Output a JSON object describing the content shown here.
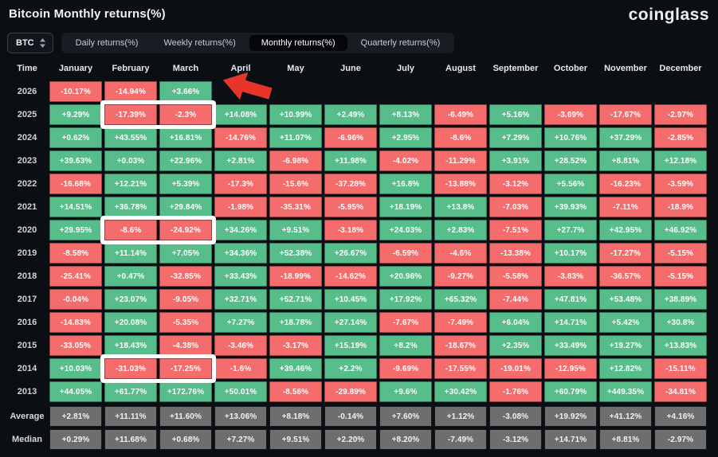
{
  "header": {
    "title": "Bitcoin Monthly returns(%)",
    "logo": "coinglass"
  },
  "controls": {
    "coin_selector": {
      "value": "BTC"
    },
    "tabs": [
      {
        "label": "Daily returns(%)",
        "active": false
      },
      {
        "label": "Weekly returns(%)",
        "active": false
      },
      {
        "label": "Monthly returns(%)",
        "active": true
      },
      {
        "label": "Quarterly returns(%)",
        "active": false
      }
    ]
  },
  "chart_data": {
    "type": "heatmap",
    "title": "Bitcoin Monthly returns(%)",
    "columns": [
      "Time",
      "January",
      "February",
      "March",
      "April",
      "May",
      "June",
      "July",
      "August",
      "September",
      "October",
      "November",
      "December"
    ],
    "rows": [
      {
        "label": "2026",
        "kind": "year",
        "values": [
          "-10.17%",
          "-14.94%",
          "+3.66%",
          "",
          "",
          "",
          "",
          "",
          "",
          "",
          "",
          ""
        ]
      },
      {
        "label": "2025",
        "kind": "year",
        "values": [
          "+9.29%",
          "-17.39%",
          "-2.3%",
          "+14.08%",
          "+10.99%",
          "+2.49%",
          "+8.13%",
          "-6.49%",
          "+5.16%",
          "-3.69%",
          "-17.67%",
          "-2.97%"
        ]
      },
      {
        "label": "2024",
        "kind": "year",
        "values": [
          "+0.62%",
          "+43.55%",
          "+16.81%",
          "-14.76%",
          "+11.07%",
          "-6.96%",
          "+2.95%",
          "-8.6%",
          "+7.29%",
          "+10.76%",
          "+37.29%",
          "-2.85%"
        ]
      },
      {
        "label": "2023",
        "kind": "year",
        "values": [
          "+39.63%",
          "+0.03%",
          "+22.96%",
          "+2.81%",
          "-6.98%",
          "+11.98%",
          "-4.02%",
          "-11.29%",
          "+3.91%",
          "+28.52%",
          "+8.81%",
          "+12.18%"
        ]
      },
      {
        "label": "2022",
        "kind": "year",
        "values": [
          "-16.68%",
          "+12.21%",
          "+5.39%",
          "-17.3%",
          "-15.6%",
          "-37.28%",
          "+16.8%",
          "-13.88%",
          "-3.12%",
          "+5.56%",
          "-16.23%",
          "-3.59%"
        ]
      },
      {
        "label": "2021",
        "kind": "year",
        "values": [
          "+14.51%",
          "+36.78%",
          "+29.84%",
          "-1.98%",
          "-35.31%",
          "-5.95%",
          "+18.19%",
          "+13.8%",
          "-7.03%",
          "+39.93%",
          "-7.11%",
          "-18.9%"
        ]
      },
      {
        "label": "2020",
        "kind": "year",
        "values": [
          "+29.95%",
          "-8.6%",
          "-24.92%",
          "+34.26%",
          "+9.51%",
          "-3.18%",
          "+24.03%",
          "+2.83%",
          "-7.51%",
          "+27.7%",
          "+42.95%",
          "+46.92%"
        ]
      },
      {
        "label": "2019",
        "kind": "year",
        "values": [
          "-8.58%",
          "+11.14%",
          "+7.05%",
          "+34.36%",
          "+52.38%",
          "+26.67%",
          "-6.59%",
          "-4.6%",
          "-13.38%",
          "+10.17%",
          "-17.27%",
          "-5.15%"
        ]
      },
      {
        "label": "2018",
        "kind": "year",
        "values": [
          "-25.41%",
          "+0.47%",
          "-32.85%",
          "+33.43%",
          "-18.99%",
          "-14.62%",
          "+20.96%",
          "-9.27%",
          "-5.58%",
          "-3.83%",
          "-36.57%",
          "-5.15%"
        ]
      },
      {
        "label": "2017",
        "kind": "year",
        "values": [
          "-0.04%",
          "+23.07%",
          "-9.05%",
          "+32.71%",
          "+52.71%",
          "+10.45%",
          "+17.92%",
          "+65.32%",
          "-7.44%",
          "+47.81%",
          "+53.48%",
          "+38.89%"
        ]
      },
      {
        "label": "2016",
        "kind": "year",
        "values": [
          "-14.83%",
          "+20.08%",
          "-5.35%",
          "+7.27%",
          "+18.78%",
          "+27.14%",
          "-7.67%",
          "-7.49%",
          "+6.04%",
          "+14.71%",
          "+5.42%",
          "+30.8%"
        ]
      },
      {
        "label": "2015",
        "kind": "year",
        "values": [
          "-33.05%",
          "+18.43%",
          "-4.38%",
          "-3.46%",
          "-3.17%",
          "+15.19%",
          "+8.2%",
          "-18.67%",
          "+2.35%",
          "+33.49%",
          "+19.27%",
          "+13.83%"
        ]
      },
      {
        "label": "2014",
        "kind": "year",
        "values": [
          "+10.03%",
          "-31.03%",
          "-17.25%",
          "-1.6%",
          "+39.46%",
          "+2.2%",
          "-9.69%",
          "-17.55%",
          "-19.01%",
          "-12.95%",
          "+12.82%",
          "-15.11%"
        ]
      },
      {
        "label": "2013",
        "kind": "year",
        "values": [
          "+44.05%",
          "+61.77%",
          "+172.76%",
          "+50.01%",
          "-8.56%",
          "-29.89%",
          "+9.6%",
          "+30.42%",
          "-1.76%",
          "+60.79%",
          "+449.35%",
          "-34.81%"
        ]
      },
      {
        "label": "Average",
        "kind": "summary",
        "values": [
          "+2.81%",
          "+11.11%",
          "+11.60%",
          "+13.06%",
          "+8.18%",
          "-0.14%",
          "+7.60%",
          "+1.12%",
          "-3.08%",
          "+19.92%",
          "+41.12%",
          "+4.16%"
        ]
      },
      {
        "label": "Median",
        "kind": "summary",
        "values": [
          "+0.29%",
          "+11.68%",
          "+0.68%",
          "+7.27%",
          "+9.51%",
          "+2.20%",
          "+8.20%",
          "-7.49%",
          "-3.12%",
          "+14.71%",
          "+8.81%",
          "-2.97%"
        ]
      }
    ]
  },
  "annotations": {
    "highlight_boxes": [
      {
        "row": "2025",
        "from": "February",
        "to": "March"
      },
      {
        "row": "2020",
        "from": "February",
        "to": "March"
      },
      {
        "row": "2014",
        "from": "February",
        "to": "March"
      }
    ],
    "arrow": {
      "row": "2026",
      "points_at": "March",
      "direction": "left"
    }
  },
  "colors": {
    "positive": "#57bd8a",
    "negative": "#f56c6c",
    "neutral": "#6e6e6e",
    "background": "#0b0e13",
    "arrow": "#e8352b",
    "highlight": "#ffffff"
  }
}
